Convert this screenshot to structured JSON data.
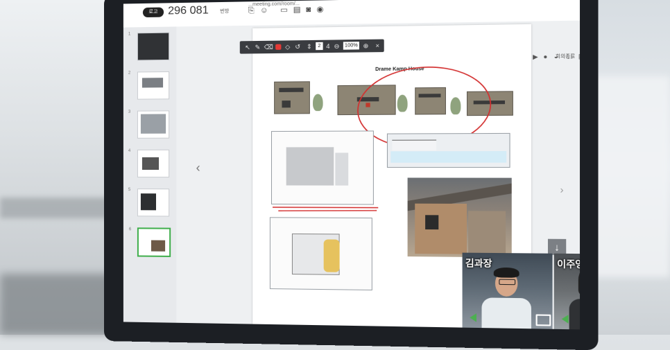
{
  "room": {
    "badge": "로고",
    "number": "296 081",
    "suffix": "번방",
    "url": "...meeting.com/room/..."
  },
  "toolbar": {
    "page_current": "2",
    "page_total": "4",
    "zoom": "100%"
  },
  "meeting_controls": {
    "label": "회의종료"
  },
  "thumbnails": [
    {
      "index": "1"
    },
    {
      "index": "2"
    },
    {
      "index": "3"
    },
    {
      "index": "4"
    },
    {
      "index": "5"
    },
    {
      "index": "6"
    }
  ],
  "document": {
    "title": "Drame Kamp House"
  },
  "participants": [
    {
      "name": "김과장"
    },
    {
      "name": "이주영"
    }
  ],
  "colors": {
    "annotation": "#d32f2f",
    "active_thumb": "#3fae4b",
    "speaking": "#4caf50"
  },
  "icons": {
    "download": "down-arrow-icon",
    "prev": "chevron-left-icon",
    "next": "chevron-right-icon"
  }
}
